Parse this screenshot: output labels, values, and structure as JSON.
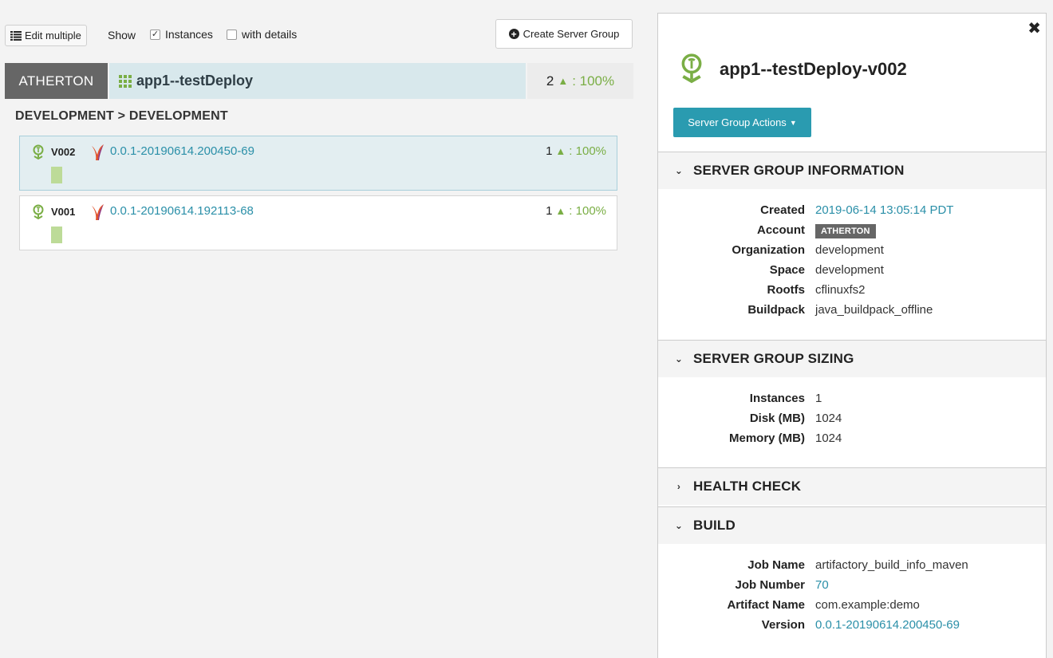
{
  "toolbar": {
    "edit_multiple": "Edit multiple",
    "show": "Show",
    "instances": "Instances",
    "instances_checked": true,
    "with_details": "with details",
    "with_details_checked": false,
    "create_server_group": "Create Server Group"
  },
  "cluster": {
    "account": "ATHERTON",
    "name": "app1--testDeploy",
    "instance_count": "2",
    "health_pct": ": 100%"
  },
  "region": "DEVELOPMENT > DEVELOPMENT",
  "server_groups": [
    {
      "version": "V002",
      "build": "0.0.1-20190614.200450-69",
      "count": "1",
      "health": ": 100%",
      "active": true,
      "instances_up": 1
    },
    {
      "version": "V001",
      "build": "0.0.1-20190614.192113-68",
      "count": "1",
      "health": ": 100%",
      "active": false,
      "instances_up": 1
    }
  ],
  "details": {
    "title": "app1--testDeploy-v002",
    "actions_label": "Server Group Actions",
    "sections": {
      "info": {
        "title": "SERVER GROUP INFORMATION",
        "expanded": true,
        "created_label": "Created",
        "created": "2019-06-14 13:05:14 PDT",
        "account_label": "Account",
        "account": "ATHERTON",
        "org_label": "Organization",
        "org": "development",
        "space_label": "Space",
        "space": "development",
        "rootfs_label": "Rootfs",
        "rootfs": "cflinuxfs2",
        "buildpack_label": "Buildpack",
        "buildpack": "java_buildpack_offline"
      },
      "sizing": {
        "title": "SERVER GROUP SIZING",
        "expanded": true,
        "instances_label": "Instances",
        "instances": "1",
        "disk_label": "Disk (MB)",
        "disk": "1024",
        "memory_label": "Memory (MB)",
        "memory": "1024"
      },
      "health": {
        "title": "HEALTH CHECK",
        "expanded": false
      },
      "build": {
        "title": "BUILD",
        "expanded": true,
        "job_name_label": "Job Name",
        "job_name": "artifactory_build_info_maven",
        "job_number_label": "Job Number",
        "job_number": "70",
        "artifact_label": "Artifact Name",
        "artifact": "com.example:demo",
        "version_label": "Version",
        "version": "0.0.1-20190614.200450-69"
      }
    }
  },
  "icons": {
    "list": "list-icon",
    "check": "checkmark-icon",
    "plus": "plus-circle-icon",
    "grid": "cluster-grid-icon",
    "pin": "cloud-foundry-pin-icon",
    "jenkins": "jenkins-feather-icon",
    "up": "triangle-up-icon",
    "close": "close-icon",
    "chevron_down": "chevron-down-icon",
    "chevron_right": "chevron-right-icon"
  },
  "colors": {
    "accent": "#2a9bb0",
    "healthy": "#7aae45",
    "link": "#2a8fa8",
    "account_badge": "#666666",
    "cluster_header": "#d8e8ec"
  }
}
